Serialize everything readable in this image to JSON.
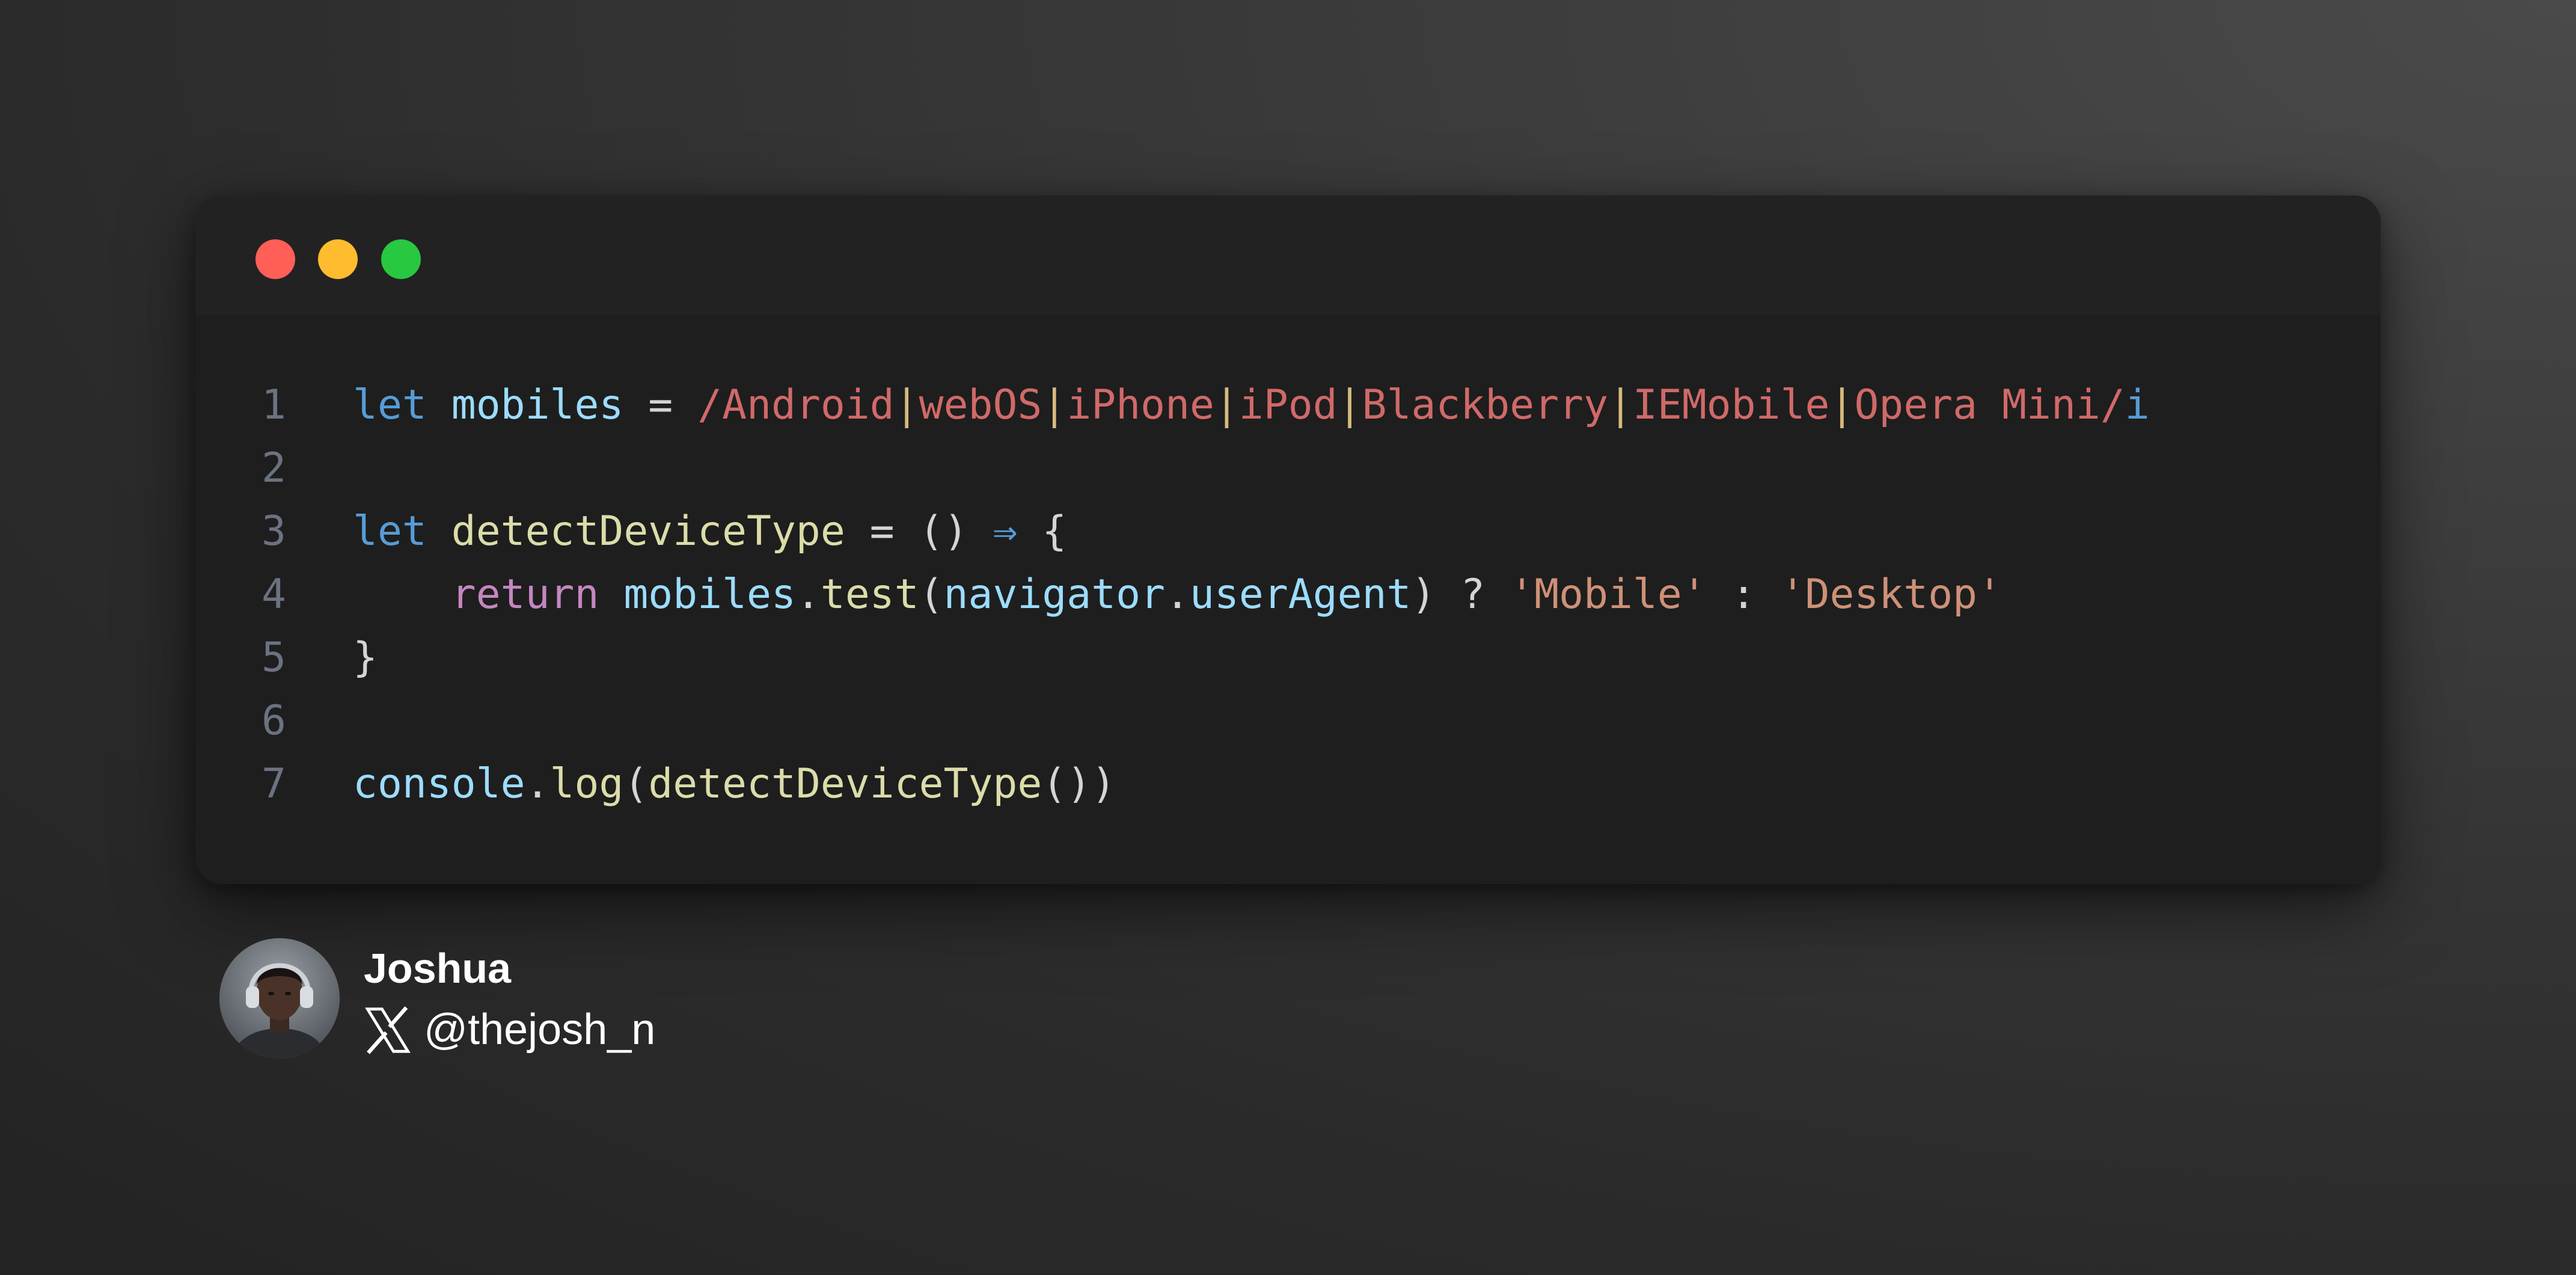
{
  "window": {
    "traffic_lights": [
      {
        "name": "close",
        "color": "#ff5f57"
      },
      {
        "name": "minimize",
        "color": "#febc2e"
      },
      {
        "name": "zoom",
        "color": "#28c840"
      }
    ]
  },
  "colors": {
    "keyword_let": "#569cd6",
    "keyword_return": "#c586c0",
    "variable": "#9cdcfe",
    "function": "#dcdcaa",
    "regex": "#d16969",
    "regex_pipe": "#d7ba7d",
    "string": "#ce9178",
    "punctuation": "#d4d4d4",
    "line_number": "#6b7280"
  },
  "code": {
    "lines": [
      {
        "number": "1",
        "tokens": [
          {
            "text": "let",
            "kind": "keyword_let"
          },
          {
            "text": " ",
            "kind": "punctuation"
          },
          {
            "text": "mobiles",
            "kind": "variable"
          },
          {
            "text": " = ",
            "kind": "punctuation"
          },
          {
            "text": "/Android",
            "kind": "regex"
          },
          {
            "text": "|",
            "kind": "regex_pipe"
          },
          {
            "text": "webOS",
            "kind": "regex"
          },
          {
            "text": "|",
            "kind": "regex_pipe"
          },
          {
            "text": "iPhone",
            "kind": "regex"
          },
          {
            "text": "|",
            "kind": "regex_pipe"
          },
          {
            "text": "iPod",
            "kind": "regex"
          },
          {
            "text": "|",
            "kind": "regex_pipe"
          },
          {
            "text": "Blackberry",
            "kind": "regex"
          },
          {
            "text": "|",
            "kind": "regex_pipe"
          },
          {
            "text": "IEMobile",
            "kind": "regex"
          },
          {
            "text": "|",
            "kind": "regex_pipe"
          },
          {
            "text": "Opera Mini/",
            "kind": "regex"
          },
          {
            "text": "i",
            "kind": "keyword_let"
          }
        ]
      },
      {
        "number": "2",
        "tokens": []
      },
      {
        "number": "3",
        "tokens": [
          {
            "text": "let",
            "kind": "keyword_let"
          },
          {
            "text": " ",
            "kind": "punctuation"
          },
          {
            "text": "detectDeviceType",
            "kind": "function"
          },
          {
            "text": " = () ",
            "kind": "punctuation"
          },
          {
            "text": "⇒",
            "kind": "keyword_let"
          },
          {
            "text": " {",
            "kind": "punctuation"
          }
        ]
      },
      {
        "number": "4",
        "tokens": [
          {
            "text": "    ",
            "kind": "punctuation"
          },
          {
            "text": "return",
            "kind": "keyword_return"
          },
          {
            "text": " ",
            "kind": "punctuation"
          },
          {
            "text": "mobiles",
            "kind": "variable"
          },
          {
            "text": ".",
            "kind": "punctuation"
          },
          {
            "text": "test",
            "kind": "function"
          },
          {
            "text": "(",
            "kind": "punctuation"
          },
          {
            "text": "navigator",
            "kind": "variable"
          },
          {
            "text": ".",
            "kind": "punctuation"
          },
          {
            "text": "userAgent",
            "kind": "variable"
          },
          {
            "text": ") ? ",
            "kind": "punctuation"
          },
          {
            "text": "'Mobile'",
            "kind": "string"
          },
          {
            "text": " : ",
            "kind": "punctuation"
          },
          {
            "text": "'Desktop'",
            "kind": "string"
          }
        ]
      },
      {
        "number": "5",
        "tokens": [
          {
            "text": "}",
            "kind": "punctuation"
          }
        ]
      },
      {
        "number": "6",
        "tokens": []
      },
      {
        "number": "7",
        "tokens": [
          {
            "text": "console",
            "kind": "variable"
          },
          {
            "text": ".",
            "kind": "punctuation"
          },
          {
            "text": "log",
            "kind": "function"
          },
          {
            "text": "(",
            "kind": "punctuation"
          },
          {
            "text": "detectDeviceType",
            "kind": "function"
          },
          {
            "text": "())",
            "kind": "punctuation"
          }
        ]
      }
    ]
  },
  "author": {
    "name": "Joshua",
    "handle": "@thejosh_n",
    "platform_icon": "x-logo-icon",
    "avatar_icon": "avatar-portrait"
  }
}
